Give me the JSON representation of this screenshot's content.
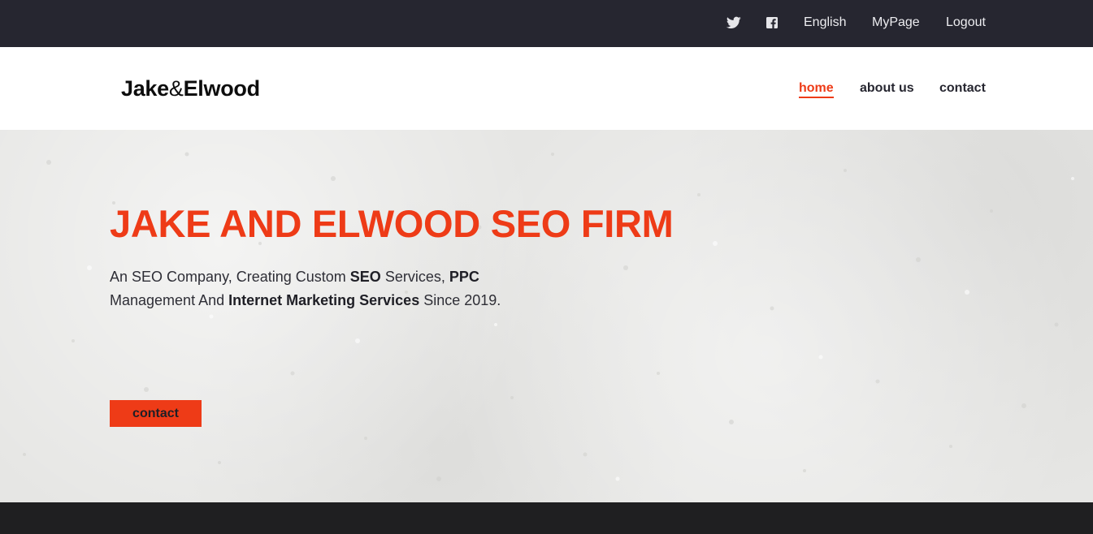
{
  "topbar": {
    "icons": [
      "twitter-icon",
      "facebook-icon"
    ],
    "language": "English",
    "mypage": "MyPage",
    "logout": "Logout"
  },
  "header": {
    "logo_left": "Jake",
    "logo_amp": "&",
    "logo_right": "Elwood",
    "nav": {
      "home": "home",
      "about": "about us",
      "contact": "contact"
    }
  },
  "hero": {
    "title": "JAKE AND ELWOOD SEO FIRM",
    "tagline": {
      "t1": "An SEO Company, Creating Custom ",
      "b1": "SEO",
      "t2": " Services, ",
      "b2": "PPC",
      "t3": " Management And ",
      "b3": "Internet Marketing Services",
      "t4": " Since 2019."
    },
    "cta_label": "contact"
  },
  "colors": {
    "accent": "#ee3b17",
    "topbar_bg": "#262630",
    "footer_bg": "#1f1f21",
    "hero_bg": "#e6e6e4"
  }
}
